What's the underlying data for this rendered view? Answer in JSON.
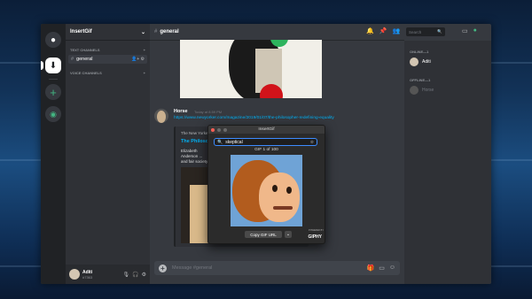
{
  "server": {
    "name": "InsertGif"
  },
  "channels": {
    "text_category": "TEXT CHANNELS",
    "voice_category": "VOICE CHANNELS",
    "items": [
      {
        "name": "general",
        "selected": true
      }
    ]
  },
  "current_user": {
    "name": "Aditi",
    "tag": "#7363"
  },
  "header": {
    "channel": "general",
    "search_placeholder": "Search"
  },
  "message": {
    "author": "Horse",
    "time": "Today at 8:59 PM",
    "link": "https://www.newyorker.com/magazine/2019/01/07/the-philosopher-redefining-equality",
    "embed": {
      "provider": "The New Yorker",
      "title": "The Philosopher Redefining Equality",
      "description": "Elizabeth Anderson ... and fair society"
    }
  },
  "composer": {
    "placeholder": "Message #general"
  },
  "members": {
    "online_label": "ONLINE—1",
    "offline_label": "OFFLINE—1",
    "online": [
      {
        "name": "Aditi"
      }
    ],
    "offline": [
      {
        "name": "Horse"
      }
    ]
  },
  "popup": {
    "title": "InsertGif",
    "query": "skeptical",
    "counter": "GIF 1 of 100",
    "copy_label": "Copy GIF URL",
    "powered_by": "POWERED BY",
    "brand": "GIPHY"
  },
  "colors": {
    "accent": "#7289da",
    "online": "#43b581",
    "link": "#00b0f4",
    "focus": "#3d8cff"
  }
}
